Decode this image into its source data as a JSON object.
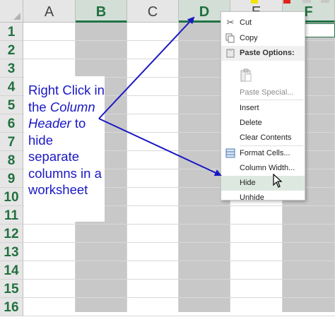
{
  "columns": [
    {
      "label": "A",
      "selected": false
    },
    {
      "label": "B",
      "selected": true
    },
    {
      "label": "C",
      "selected": false
    },
    {
      "label": "D",
      "selected": true
    },
    {
      "label": "E",
      "selected": false
    },
    {
      "label": "F",
      "selected": true
    }
  ],
  "rows": [
    "1",
    "2",
    "3",
    "4",
    "5",
    "6",
    "7",
    "8",
    "9",
    "10",
    "11",
    "12",
    "13",
    "14",
    "15",
    "16"
  ],
  "annotation": {
    "line1": "Right Click in",
    "line2_prefix": "the ",
    "line2_italic": "Column",
    "line3_italic": "Header",
    "line3_suffix": " to",
    "line4": "hide",
    "line5": "separate",
    "line6": "columns in a",
    "line7": "worksheet"
  },
  "context_menu": {
    "cut": "Cut",
    "copy": "Copy",
    "paste_options": "Paste Options:",
    "paste_special": "Paste Special...",
    "insert": "Insert",
    "delete": "Delete",
    "clear_contents": "Clear Contents",
    "format_cells": "Format Cells...",
    "column_width": "Column Width...",
    "hide": "Hide",
    "unhide": "Unhide"
  },
  "colors": {
    "annotation_text": "#1a18c4",
    "selected_header": "#217346",
    "selected_column": "#c8c8c8",
    "menu_highlight": "#dde9e0"
  }
}
